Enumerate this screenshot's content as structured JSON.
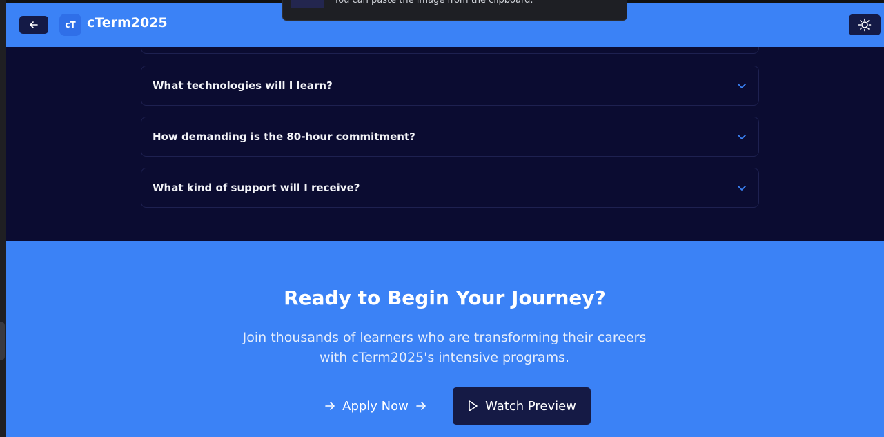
{
  "header": {
    "logo_text": "cT",
    "brand": "cTerm2025",
    "back_icon": "arrow-left-icon",
    "theme_icon": "sun-icon"
  },
  "toast": {
    "message": "You can paste the image from the clipboard."
  },
  "faq": {
    "items": [
      {
        "question": "What technologies will I learn?"
      },
      {
        "question": "How demanding is the 80-hour commitment?"
      },
      {
        "question": "What kind of support will I receive?"
      }
    ],
    "chevron_color": "#3b82f6"
  },
  "cta": {
    "title": "Ready to Begin Your Journey?",
    "subtitle": "Join thousands of learners who are transforming their careers with cTerm2025's intensive programs.",
    "apply_label": "Apply Now",
    "watch_label": "Watch Preview"
  },
  "colors": {
    "accent": "#3b82f6",
    "dark_bg": "#0b0c31",
    "button_dark": "#151a45"
  }
}
